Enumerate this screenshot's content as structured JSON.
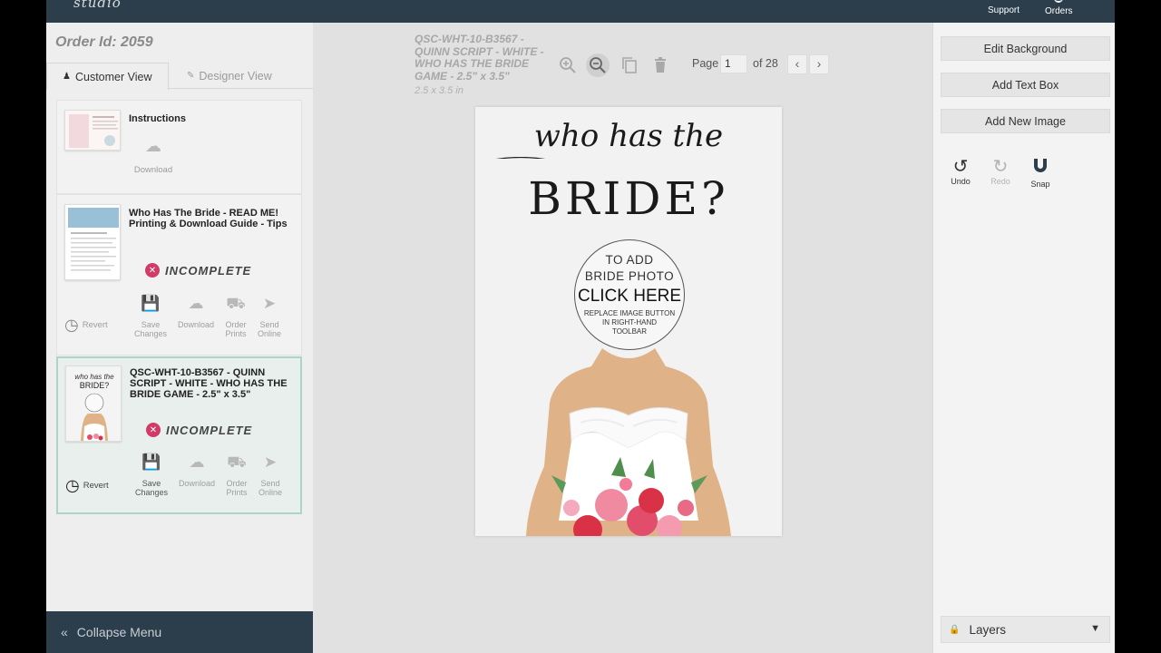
{
  "brand": "studio",
  "topnav": {
    "support": "Support",
    "orders": "Orders"
  },
  "order": {
    "label": "Order Id: 2059"
  },
  "tabs": [
    {
      "label": "Customer View"
    },
    {
      "label": "Designer View"
    }
  ],
  "cards": [
    {
      "title": "Instructions",
      "download": "Download"
    },
    {
      "title": "Who Has The Bride - READ ME! Printing & Download Guide - Tips",
      "status": "INCOMPLETE"
    },
    {
      "title": "QSC-WHT-10-B3567 - QUINN SCRIPT - WHITE - WHO HAS THE BRIDE GAME - 2.5\" x 3.5\"",
      "status": "INCOMPLETE"
    }
  ],
  "actions": {
    "revert": "Revert",
    "save": "Save Changes",
    "download": "Download",
    "order_prints": "Order Prints",
    "send_online": "Send Online"
  },
  "collapse": "Collapse Menu",
  "document": {
    "title": "QSC-WHT-10-B3567 - QUINN SCRIPT - WHITE - WHO HAS THE BRIDE GAME - 2.5\" x 3.5\"",
    "size": "2.5 x 3.5 in"
  },
  "pager": {
    "page_label": "Page",
    "current": "1",
    "of_label": "of 28"
  },
  "canvas": {
    "script": "who has the",
    "headline": "BRIDE?",
    "photo_line1": "TO ADD",
    "photo_line2": "BRIDE PHOTO",
    "photo_line3": "CLICK HERE",
    "photo_line4": "REPLACE IMAGE BUTTON",
    "photo_line5": "IN RIGHT-HAND",
    "photo_line6": "TOOLBAR"
  },
  "right": {
    "edit_background": "Edit Background",
    "add_text_box": "Add Text Box",
    "add_new_image": "Add New Image",
    "undo": "Undo",
    "redo": "Redo",
    "snap": "Snap",
    "layers": "Layers"
  },
  "colors": {
    "header": "#2c3e4c",
    "incomplete": "#d23b67",
    "selected_card_border": "#a9d7c4",
    "skin": "#e0b287",
    "rose": "#e24d6b"
  }
}
